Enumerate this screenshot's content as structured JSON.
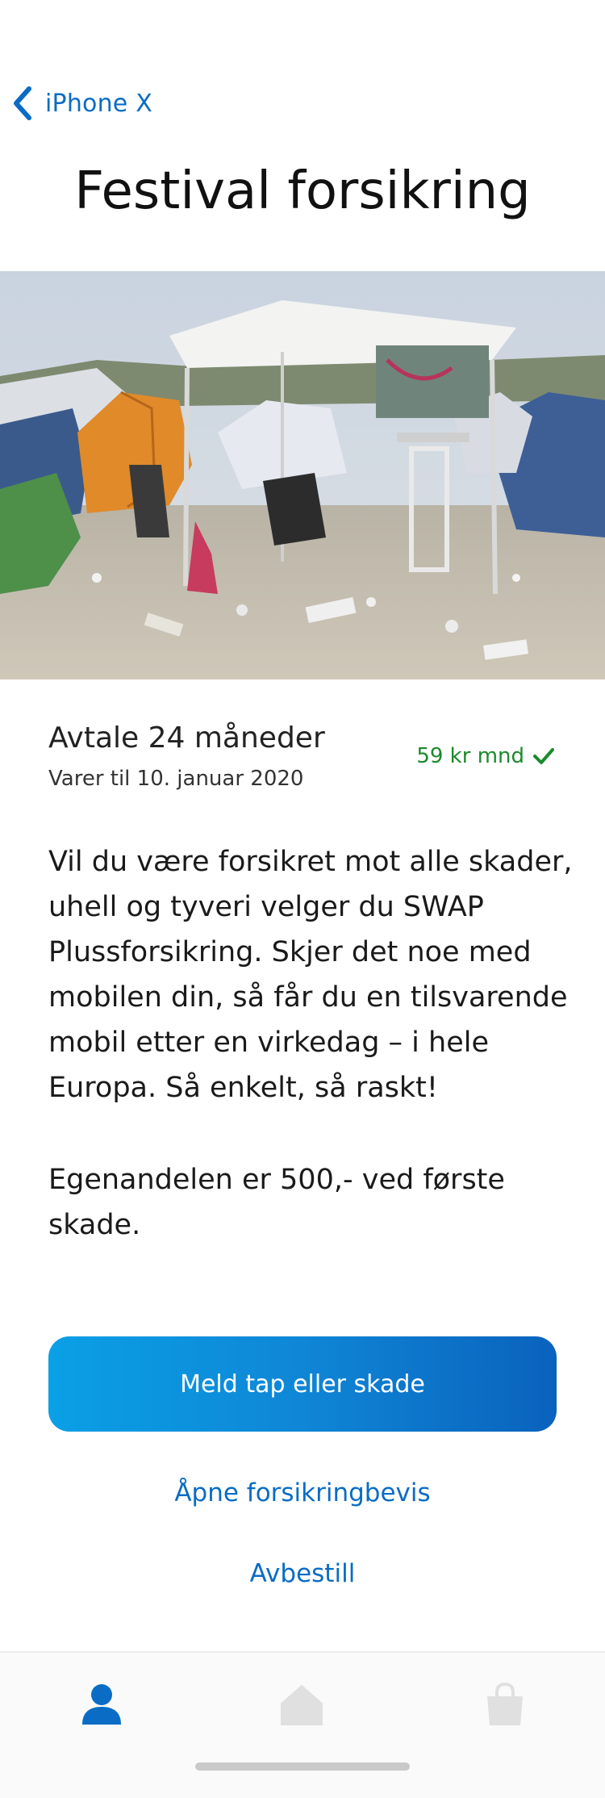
{
  "nav": {
    "back_label": "iPhone X"
  },
  "page": {
    "title": "Festival forsikring"
  },
  "hero": {
    "image_alt": "Campsite tents and gazebo at a festival"
  },
  "plan": {
    "title": "Avtale 24 måneder",
    "subtitle": "Varer til 10. januar 2020",
    "price": "59 kr mnd"
  },
  "description": {
    "paragraph_1": "Vil du være forsikret mot alle skader, uhell og tyveri velger du SWAP Plussforsikring. Skjer det noe med mobilen din, så får du en tilsvarende mobil etter en virkedag – i hele Europa. Så enkelt, så raskt!",
    "paragraph_2": "Egenandelen er 500,- ved første skade."
  },
  "actions": {
    "primary_label": "Meld tap eller skade",
    "open_certificate_label": "Åpne forsikringbevis",
    "cancel_label": "Avbestill"
  },
  "tabbar": {
    "tabs": [
      {
        "icon": "person-icon",
        "active": true
      },
      {
        "icon": "home-icon",
        "active": false
      },
      {
        "icon": "shopping-bag-icon",
        "active": false
      }
    ]
  },
  "colors": {
    "accent": "#0a6cc4",
    "price_green": "#1a8a2b",
    "button_gradient_start": "#0aa0e6",
    "button_gradient_end": "#0a62bd",
    "tab_inactive": "#e0e0e0"
  }
}
